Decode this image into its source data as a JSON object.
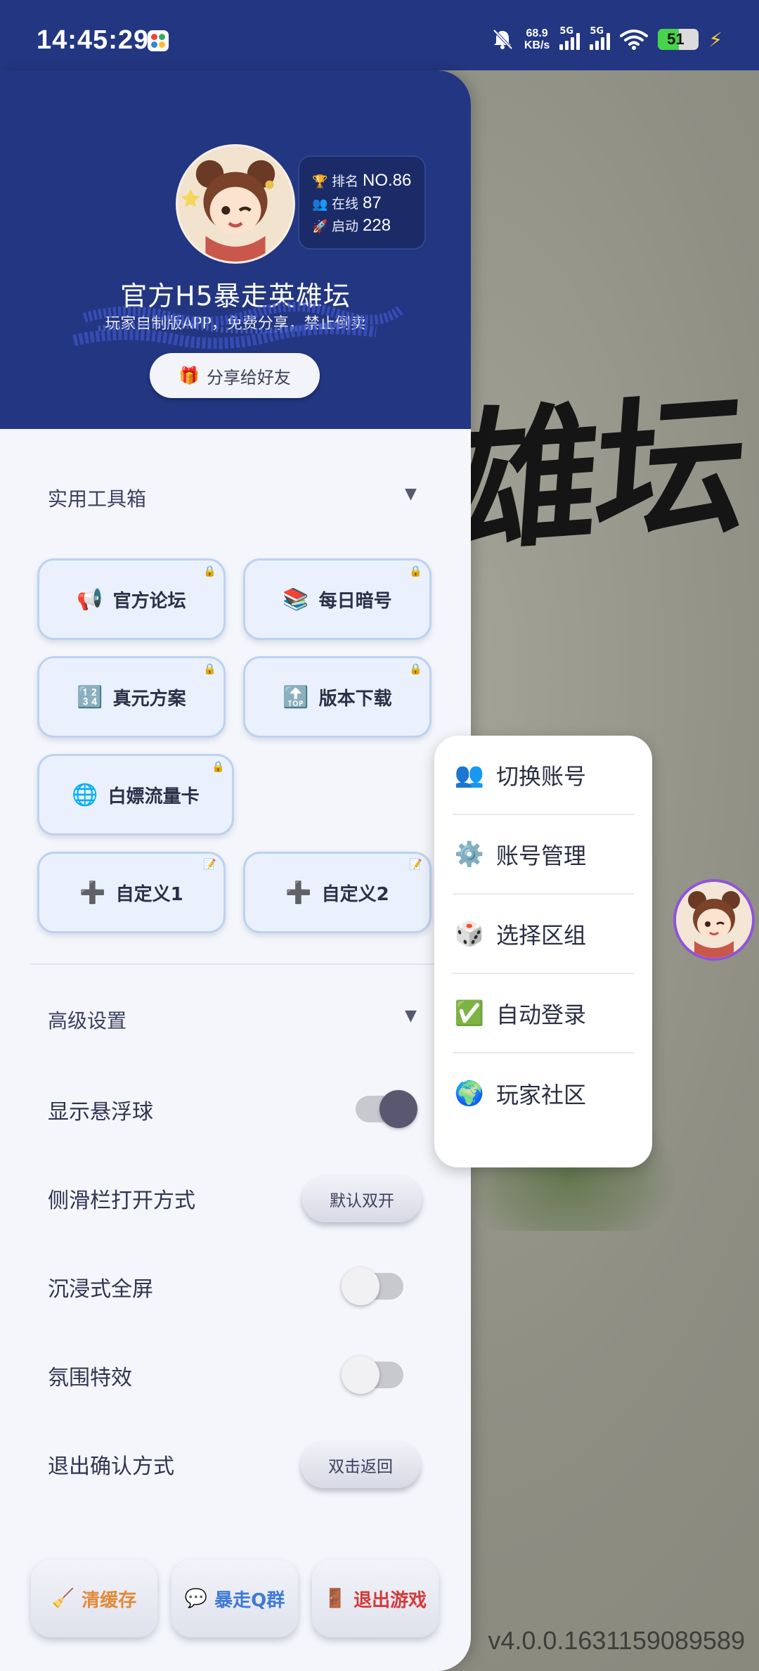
{
  "status_bar": {
    "time": "14:45:29",
    "net_speed_value": "68.9",
    "net_speed_unit": "KB/s",
    "signal_1": "5G",
    "signal_2": "5G",
    "battery": "51"
  },
  "drawer": {
    "stats": {
      "rank_icon": "trophy-icon",
      "rank_label": "排名",
      "rank_value": "NO.86",
      "online_icon": "users-icon",
      "online_label": "在线",
      "online_value": "87",
      "launch_icon": "rocket-icon",
      "launch_label": "启动",
      "launch_value": "228"
    },
    "title": "官方H5暴走英雄坛",
    "subtitle": "玩家自制版APP，免费分享，禁止倒卖",
    "share_button": {
      "icon": "gift-icon",
      "glyph": "🎁",
      "label": "分享给好友"
    },
    "toolbox": {
      "title": "实用工具箱",
      "arrow": "▼",
      "tools": [
        {
          "icon": "megaphone-icon",
          "glyph": "📢",
          "label": "官方论坛"
        },
        {
          "icon": "books-icon",
          "glyph": "📚",
          "label": "每日暗号"
        },
        {
          "icon": "numbers-icon",
          "glyph": "🔢",
          "label": "真元方案"
        },
        {
          "icon": "top-arrow-icon",
          "glyph": "🔝",
          "label": "版本下载"
        },
        {
          "icon": "globe-icon",
          "glyph": "🌐",
          "label": "白嫖流量卡"
        },
        {
          "icon": "plus-icon",
          "glyph": "➕",
          "label": "自定义1"
        },
        {
          "icon": "plus-icon",
          "glyph": "➕",
          "label": "自定义2"
        }
      ]
    },
    "advanced": {
      "title": "高级设置",
      "arrow": "▼",
      "floating_ball": {
        "label": "显示悬浮球",
        "on": true
      },
      "sidebar_mode": {
        "label": "侧滑栏打开方式",
        "button": "默认双开"
      },
      "immersive": {
        "label": "沉浸式全屏",
        "on": false
      },
      "atmosphere": {
        "label": "氛围特效",
        "on": false
      },
      "exit_confirm": {
        "label": "退出确认方式",
        "button": "双击返回"
      }
    },
    "bottom": {
      "clear_cache": {
        "icon": "broom-icon",
        "glyph": "🧹",
        "label": "清缓存",
        "color": "#e08a3a"
      },
      "qq_group": {
        "icon": "chat-bubble-icon",
        "glyph": "💬",
        "label": "暴走Q群",
        "color": "#3d7ad6"
      },
      "exit_game": {
        "icon": "door-icon",
        "glyph": "🚪",
        "label": "退出游戏",
        "color": "#d43a3a"
      }
    }
  },
  "popup_menu": {
    "items": [
      {
        "icon": "users-icon",
        "glyph": "👥",
        "label": "切换账号"
      },
      {
        "icon": "gear-icon",
        "glyph": "⚙️",
        "label": "账号管理"
      },
      {
        "icon": "dice-icon",
        "glyph": "🎲",
        "label": "选择区组"
      },
      {
        "icon": "check-icon",
        "glyph": "✅",
        "label": "自动登录"
      },
      {
        "icon": "earth-icon",
        "glyph": "🌍",
        "label": "玩家社区"
      }
    ]
  },
  "game": {
    "logo_text": "雄坛",
    "version": "v4.0.0.1631159089589"
  },
  "colors": {
    "header_blue": "#233681",
    "drawer_bg": "#f4f6fb",
    "tool_bg": "#eaf1fc"
  }
}
